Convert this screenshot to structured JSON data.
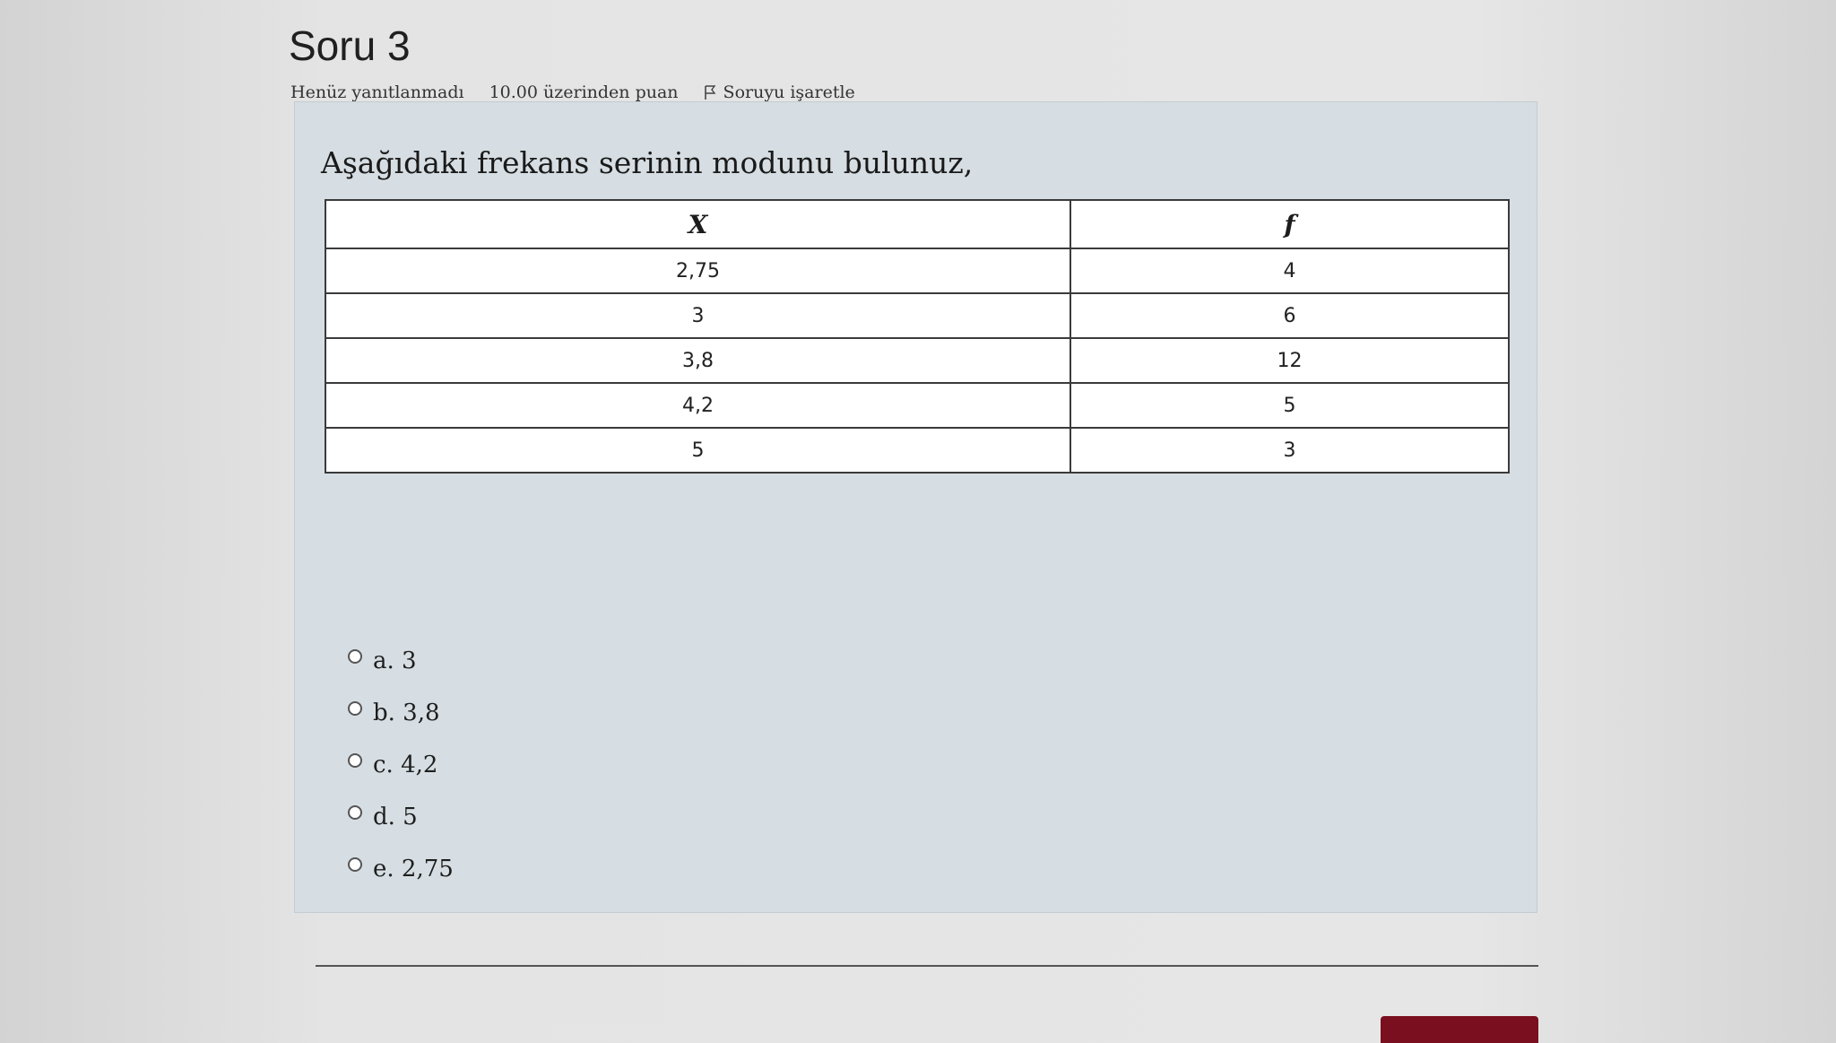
{
  "header": {
    "title": "Soru 3",
    "status": "Henüz yanıtlanmadı",
    "points": "10.00 üzerinden puan",
    "flag_label": "Soruyu işaretle"
  },
  "question": {
    "text": "Aşağıdaki frekans serinin modunu bulunuz,",
    "table": {
      "columns": [
        "X",
        "f"
      ],
      "rows": [
        [
          "2,75",
          "4"
        ],
        [
          "3",
          "6"
        ],
        [
          "3,8",
          "12"
        ],
        [
          "4,2",
          "5"
        ],
        [
          "5",
          "3"
        ]
      ]
    },
    "options": [
      {
        "label": "a. 3"
      },
      {
        "label": "b. 3,8"
      },
      {
        "label": "c. 4,2"
      },
      {
        "label": "d. 5"
      },
      {
        "label": "e. 2,75"
      }
    ]
  },
  "colors": {
    "question_bg": "#d6dee3",
    "next_button": "#7a0f1f"
  }
}
